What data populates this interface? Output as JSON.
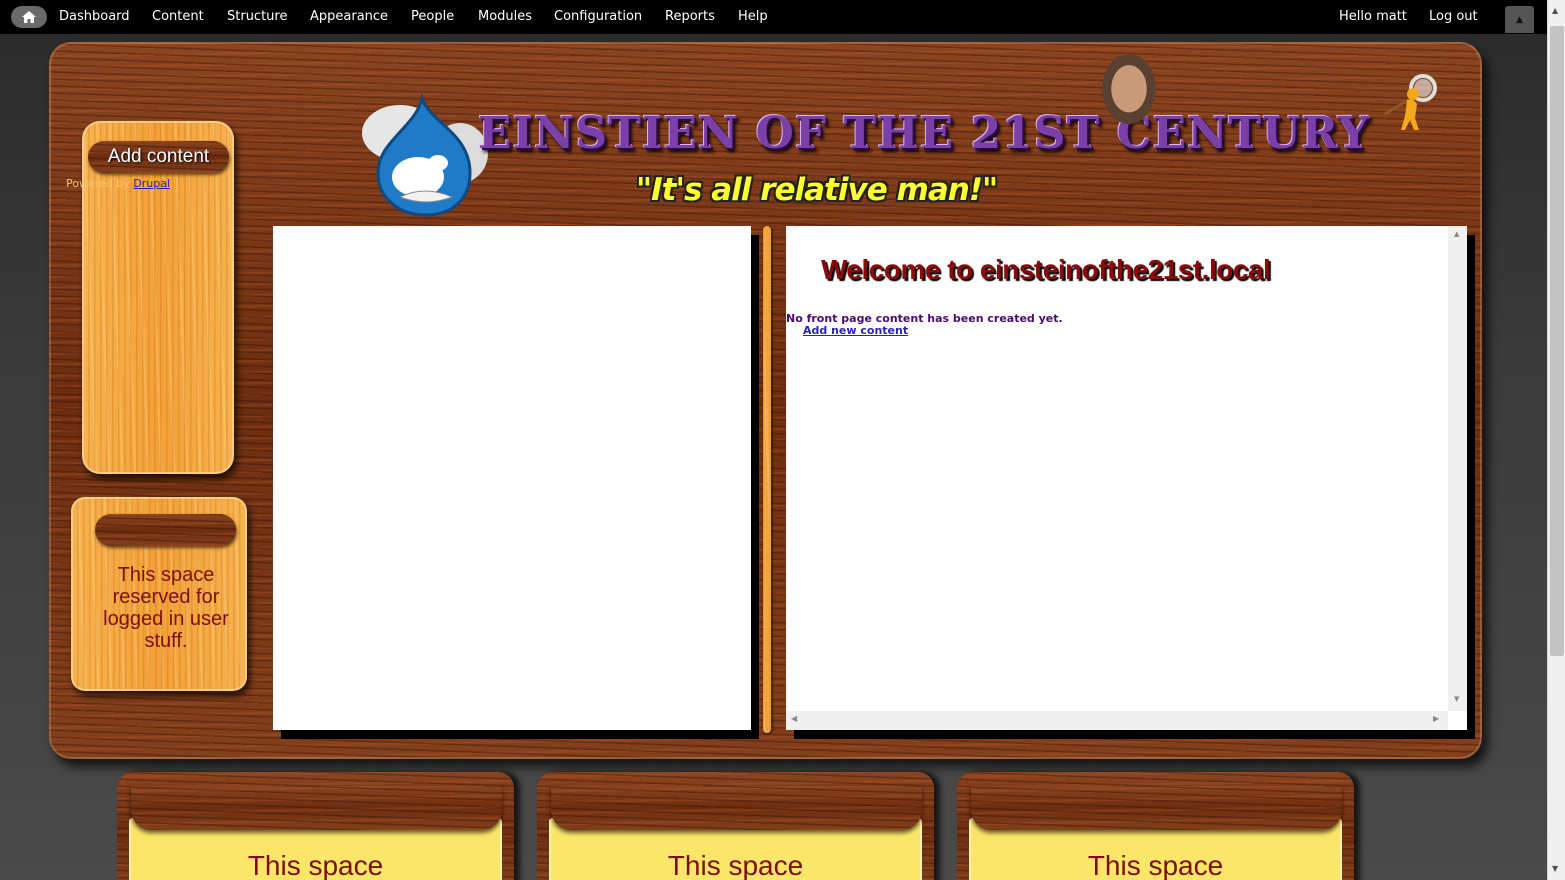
{
  "toolbar": {
    "items": [
      {
        "label": "Dashboard"
      },
      {
        "label": "Content"
      },
      {
        "label": "Structure"
      },
      {
        "label": "Appearance"
      },
      {
        "label": "People"
      },
      {
        "label": "Modules"
      },
      {
        "label": "Configuration"
      },
      {
        "label": "Reports"
      },
      {
        "label": "Help"
      }
    ],
    "greeting": "Hello matt",
    "logout": "Log out"
  },
  "header": {
    "site_name": "Einstien of the 21st Century",
    "slogan": "\"It's all relative man!\""
  },
  "sidebar": {
    "add_content": "Add content",
    "powered_prefix": "Powered by ",
    "powered_link": "Drupal",
    "login_placeholder": "This space reserved for logged in user stuff."
  },
  "main": {
    "welcome_title": "Welcome to einsteinofthe21st.local",
    "no_content_msg": "No front page content has been created yet.",
    "add_new_content": "Add new content"
  },
  "footer": {
    "columns": [
      {
        "text": "This space"
      },
      {
        "text": "This space"
      },
      {
        "text": "This space"
      }
    ]
  },
  "colors": {
    "wood_dark": "#7a3716",
    "wood_light": "#f4a63e",
    "title_red": "#8a0a0a",
    "link_blue": "#2a23b8",
    "footer_yellow": "#fbe669"
  }
}
